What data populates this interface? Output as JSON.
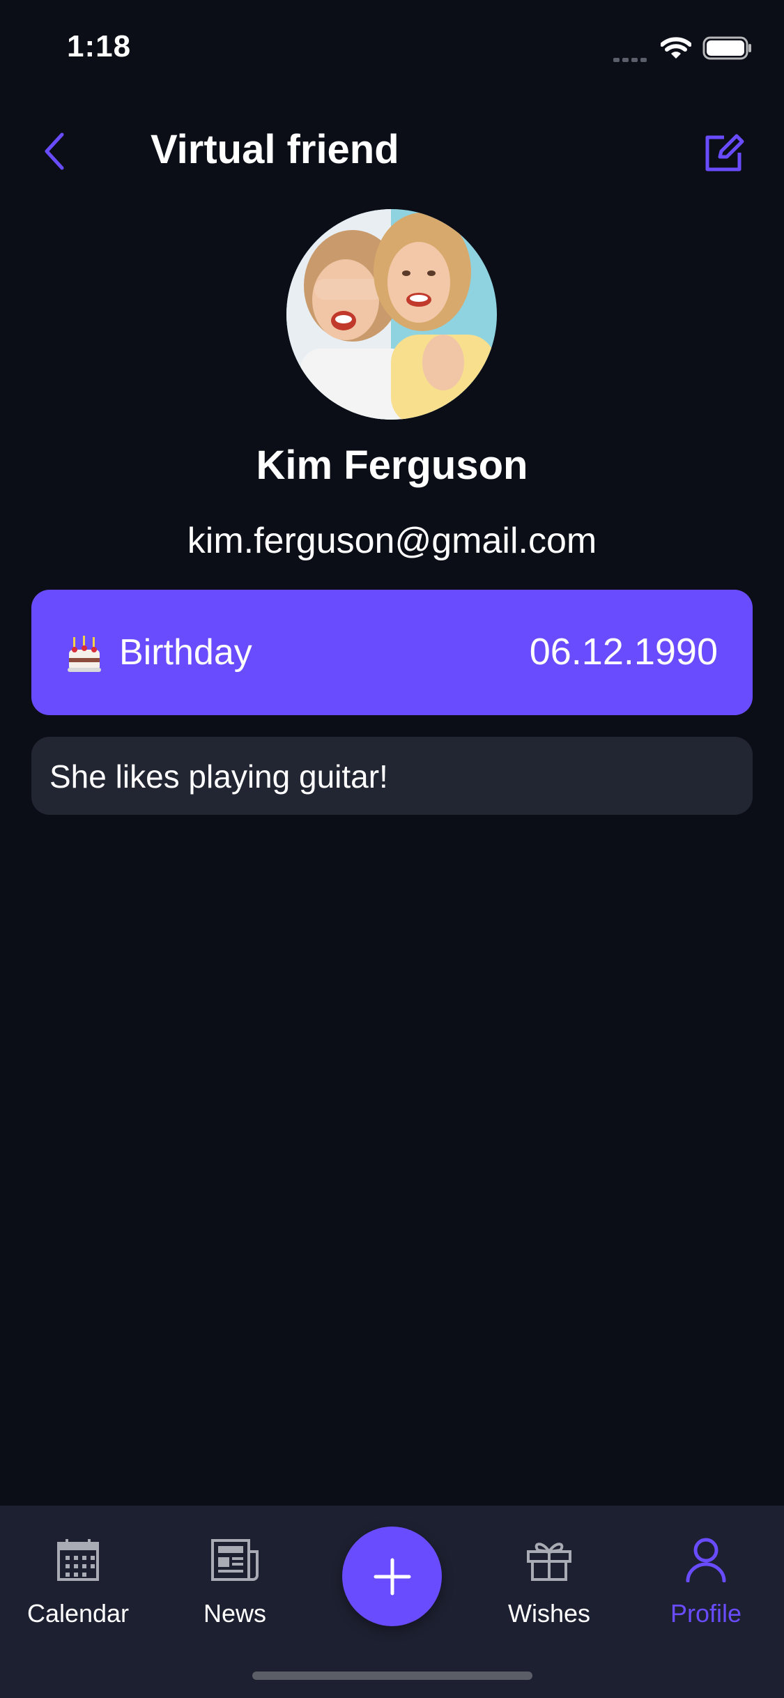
{
  "status_bar": {
    "time": "1:18"
  },
  "header": {
    "title": "Virtual friend",
    "back_icon": "chevron-left-icon",
    "edit_icon": "edit-icon"
  },
  "profile": {
    "name": "Kim Ferguson",
    "email": "kim.ferguson@gmail.com"
  },
  "birthday": {
    "label": "Birthday",
    "date": "06.12.1990",
    "icon": "cake-icon"
  },
  "note": {
    "text": "She likes playing guitar!"
  },
  "tabs": [
    {
      "label": "Calendar",
      "icon": "calendar-icon",
      "active": false
    },
    {
      "label": "News",
      "icon": "newspaper-icon",
      "active": false
    },
    {
      "label": "Wishes",
      "icon": "gift-icon",
      "active": false
    },
    {
      "label": "Profile",
      "icon": "person-icon",
      "active": true
    }
  ],
  "fab": {
    "icon": "plus-icon"
  },
  "colors": {
    "accent": "#6a4cff",
    "background": "#0b0e17",
    "card": "#222532",
    "tab_bar": "#1d2030"
  }
}
